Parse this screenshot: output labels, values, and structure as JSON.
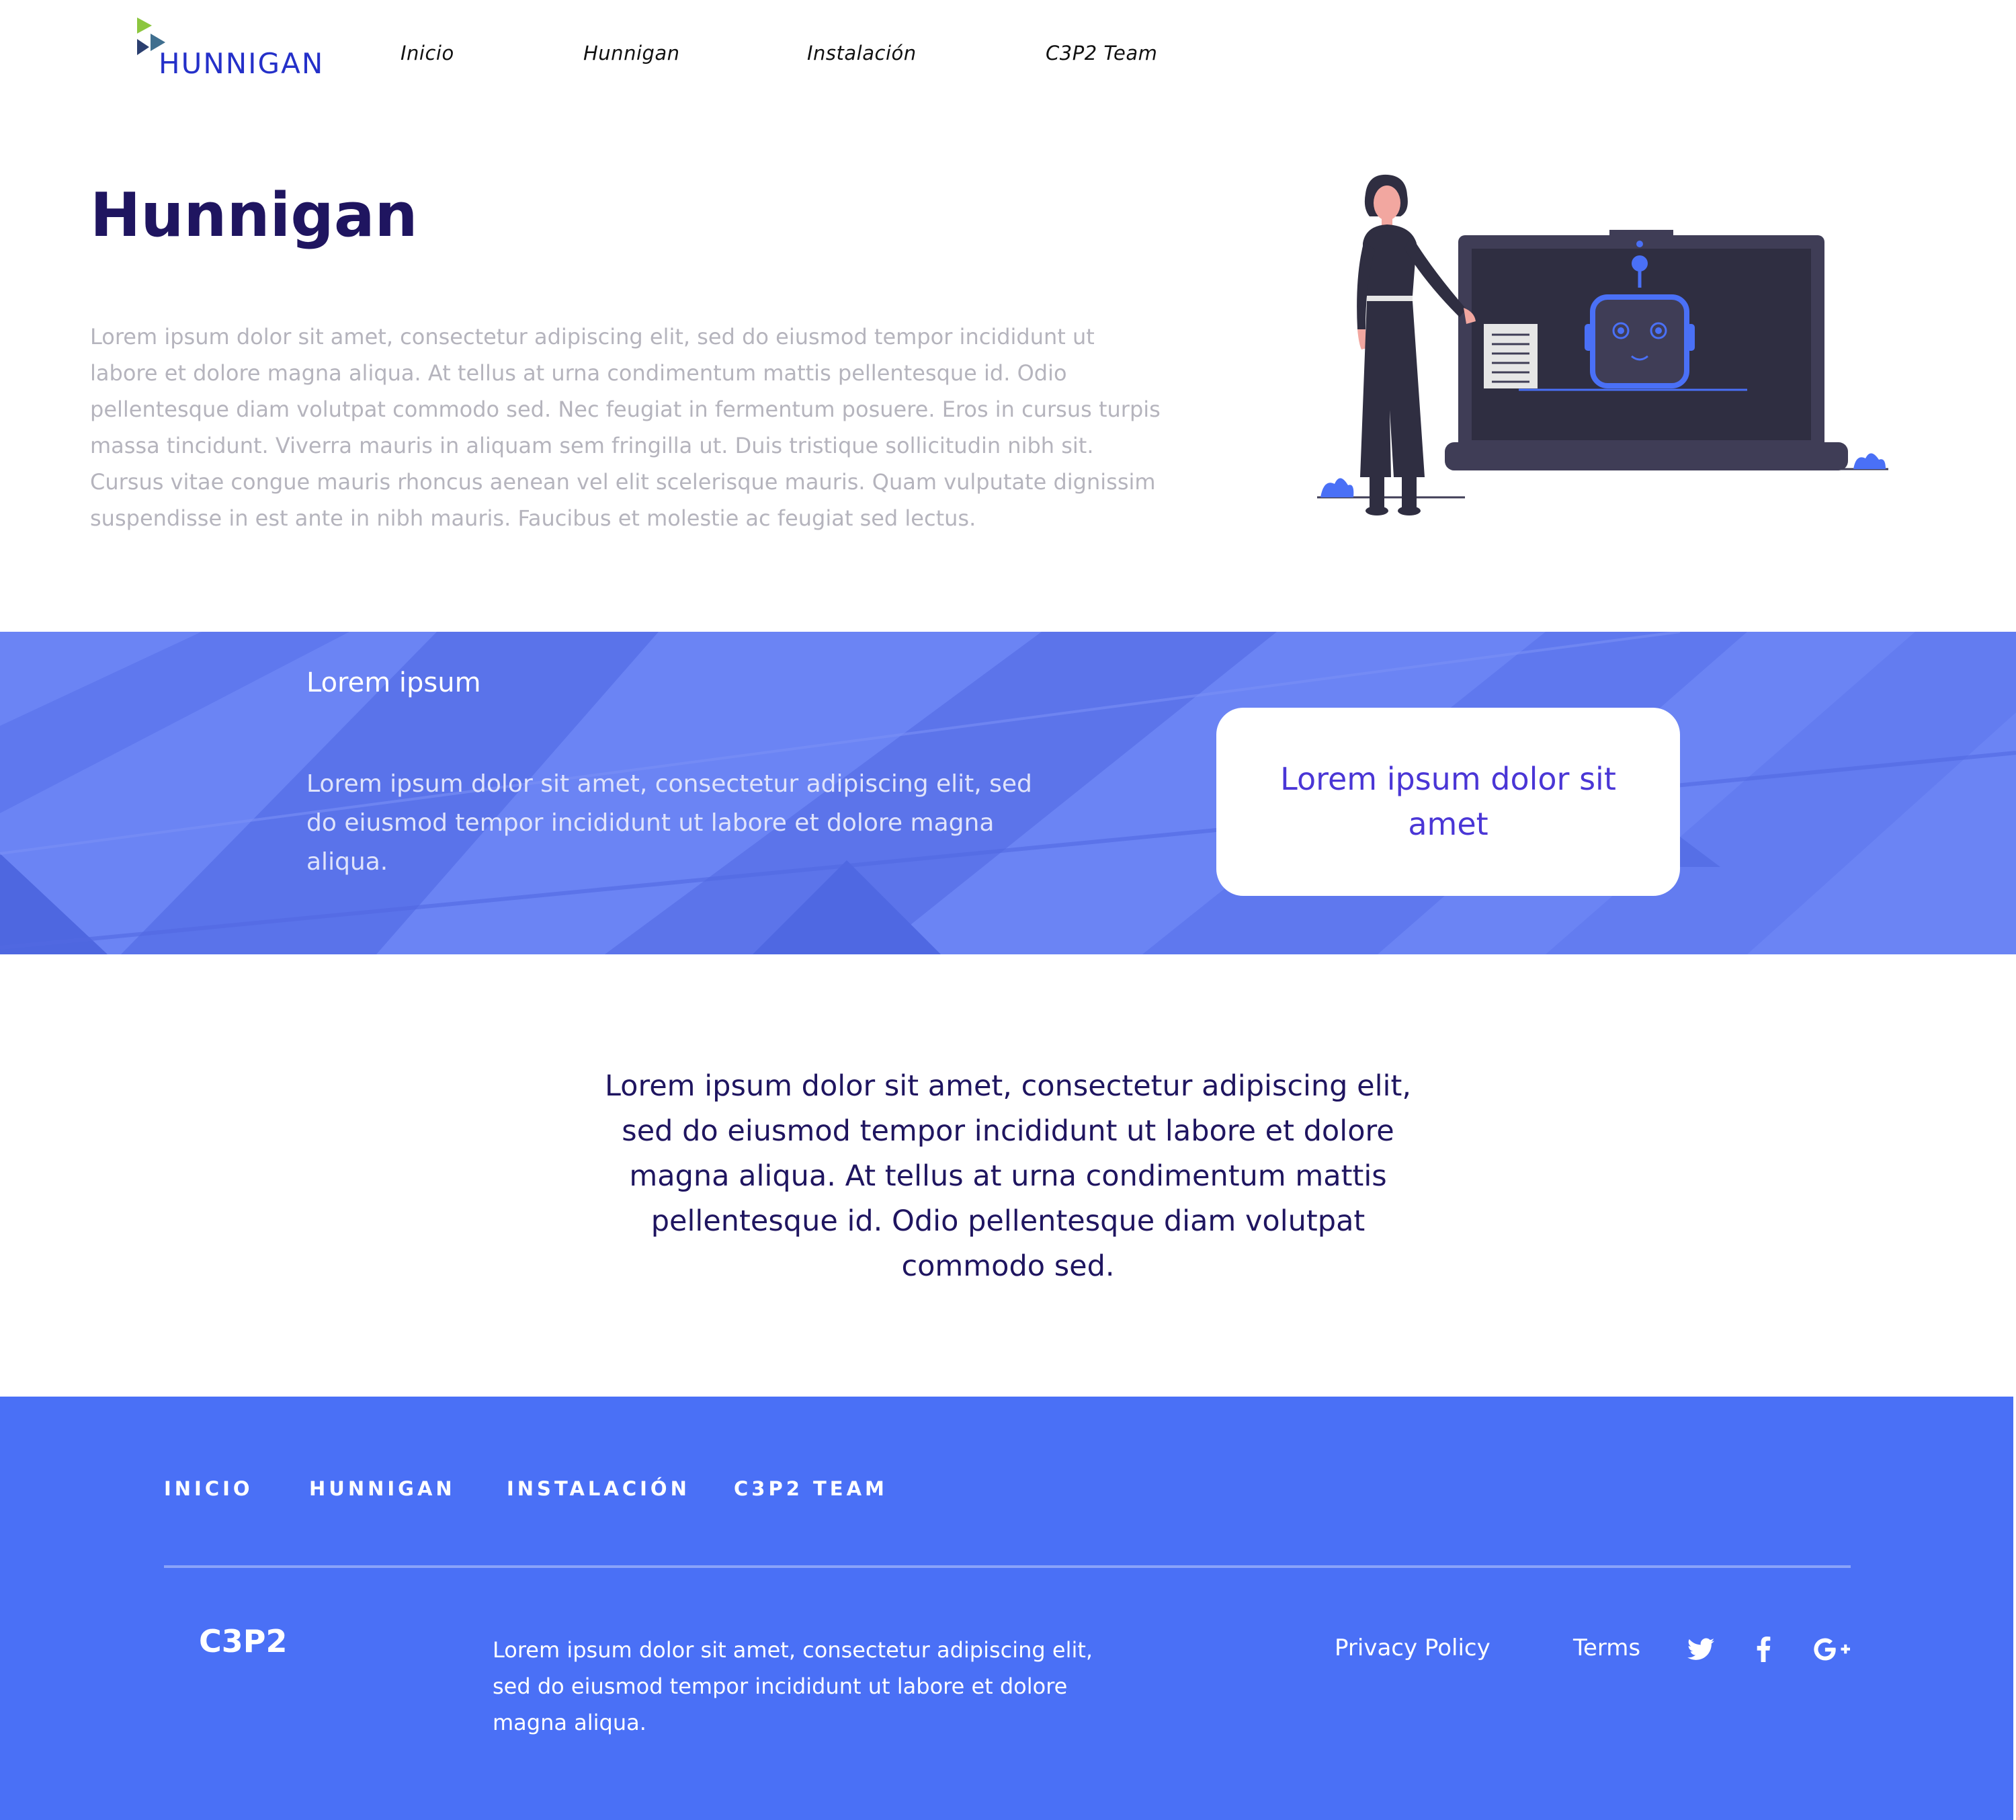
{
  "header": {
    "logo_text": "HUNNIGAN",
    "nav": [
      "Inicio",
      "Hunnigan",
      "Instalación",
      "C3P2 Team"
    ]
  },
  "hero": {
    "title": "Hunnigan",
    "text": "Lorem ipsum dolor sit amet, consectetur adipiscing elit, sed do eiusmod tempor incididunt ut labore et dolore magna aliqua. At tellus at urna condimentum mattis pellentesque id. Odio pellentesque diam volutpat commodo sed. Nec feugiat in fermentum posuere. Eros in cursus turpis massa tincidunt. Viverra mauris in aliquam sem fringilla ut. Duis tristique sollicitudin nibh sit. Cursus vitae congue mauris rhoncus aenean vel elit scelerisque mauris. Quam vulputate dignissim suspendisse in est ante in nibh mauris. Faucibus et molestie ac feugiat sed lectus."
  },
  "banner": {
    "title": "Lorem ipsum",
    "text": "Lorem ipsum dolor sit amet, consectetur adipiscing elit, sed do eiusmod tempor incididunt ut labore et dolore magna aliqua.",
    "cta_label": "Lorem ipsum dolor sit amet"
  },
  "statement": {
    "text": "Lorem ipsum dolor sit amet, consectetur adipiscing elit, sed do eiusmod tempor incididunt ut labore et dolore magna aliqua. At tellus at urna condimentum mattis pellentesque id. Odio pellentesque diam volutpat commodo sed."
  },
  "footer": {
    "nav": [
      "INICIO",
      "HUNNIGAN",
      "INSTALACIÓN",
      "C3P2 TEAM"
    ],
    "brand": "C3P2",
    "text": "Lorem ipsum dolor sit amet, consectetur adipiscing elit, sed do eiusmod tempor incididunt ut labore et dolore magna aliqua.",
    "links": [
      "Privacy Policy",
      "Terms"
    ],
    "social": [
      "twitter-icon",
      "facebook-icon",
      "google-plus-icon"
    ]
  },
  "colors": {
    "brand_dark": "#1f1560",
    "accent_blue": "#4a70f6",
    "banner_blue": "#6b84f4",
    "cta_text": "#4a36d6",
    "muted_text": "#b5b4bd"
  }
}
